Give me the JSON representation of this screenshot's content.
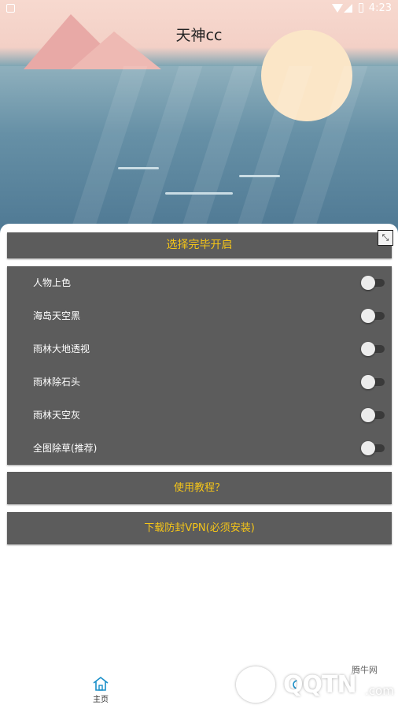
{
  "status_bar": {
    "time": "4:23"
  },
  "app": {
    "title": "天神cc"
  },
  "main": {
    "start_button": "选择完毕开启",
    "options": [
      {
        "label": "人物上色",
        "enabled": false
      },
      {
        "label": "海岛天空黑",
        "enabled": false
      },
      {
        "label": "雨林大地透视",
        "enabled": false
      },
      {
        "label": "雨林除石头",
        "enabled": false
      },
      {
        "label": "雨林天空灰",
        "enabled": false
      },
      {
        "label": "全图除草(推荐)",
        "enabled": false
      }
    ],
    "tutorial_button": "使用教程？",
    "vpn_button": "下载防封VPN(必须安装)"
  },
  "nav": {
    "home_label": "主页"
  },
  "watermark": {
    "brand": "QQTN",
    "site_suffix": ".com",
    "cn_name": "腾牛网"
  },
  "colors": {
    "accent": "#f5c518",
    "bar": "#5c5c5c"
  }
}
